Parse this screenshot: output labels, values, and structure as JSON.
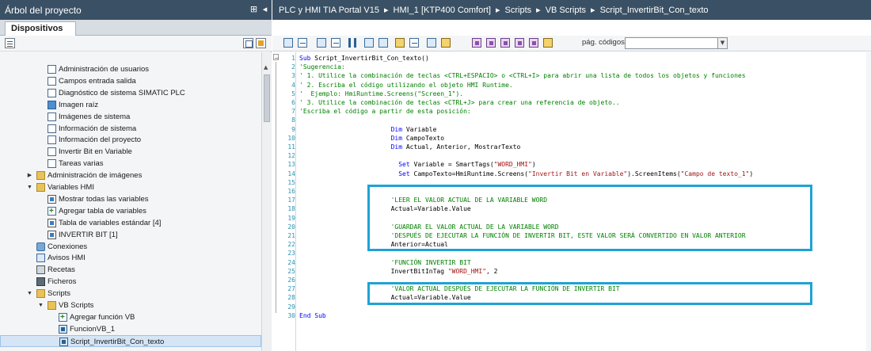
{
  "colors": {
    "titlebar_bg": "#3a5064",
    "selection_bg": "#d5e5f5",
    "keyword": "#0000ff",
    "comment": "#008000",
    "string": "#a31515",
    "line_number": "#2b91af",
    "highlight_box": "#1fa2d6"
  },
  "left_pane": {
    "title": "Árbol del proyecto",
    "pin_icon": "⊞",
    "collapse_icon": "◂",
    "tab_label": "Dispositivos",
    "tree": [
      {
        "label": "Administración de usuarios",
        "icon": "screen-icon"
      },
      {
        "label": "Campos entrada salida",
        "icon": "screen-icon"
      },
      {
        "label": "Diagnóstico de sistema SIMATIC PLC",
        "icon": "screen-icon"
      },
      {
        "label": "Imagen raíz",
        "icon": "screen-icon-blue"
      },
      {
        "label": "Imágenes de sistema",
        "icon": "screen-icon"
      },
      {
        "label": "Información de sistema",
        "icon": "screen-icon"
      },
      {
        "label": "Información del proyecto",
        "icon": "screen-icon"
      },
      {
        "label": "Invertir Bit en Variable",
        "icon": "screen-icon"
      },
      {
        "label": "Tareas varias",
        "icon": "screen-icon"
      },
      {
        "label": "Administración de imágenes",
        "icon": "folder-icon",
        "expander": "▶"
      },
      {
        "label": "Variables HMI",
        "icon": "folder-icon",
        "expander": "▼"
      },
      {
        "label": "Mostrar todas las variables",
        "icon": "tag-table-icon"
      },
      {
        "label": "Agregar tabla de variables",
        "icon": "add-icon"
      },
      {
        "label": "Tabla de variables estándar [4]",
        "icon": "tag-table-icon"
      },
      {
        "label": "INVERTIR BIT [1]",
        "icon": "tag-table-icon"
      },
      {
        "label": "Conexiones",
        "icon": "connection-icon"
      },
      {
        "label": "Avisos HMI",
        "icon": "alarm-icon"
      },
      {
        "label": "Recetas",
        "icon": "recipe-icon"
      },
      {
        "label": "Ficheros",
        "icon": "archive-icon"
      },
      {
        "label": "Scripts",
        "icon": "folder-icon",
        "expander": "▼"
      },
      {
        "label": "VB Scripts",
        "icon": "folder-icon",
        "expander": "▼"
      },
      {
        "label": "Agregar función VB",
        "icon": "add-icon"
      },
      {
        "label": "FuncionVB_1",
        "icon": "vb-script-icon"
      },
      {
        "label": "Script_InvertirBit_Con_texto",
        "icon": "vb-script-icon",
        "selected": true
      }
    ]
  },
  "breadcrumb": [
    "PLC y HMI TIA Portal V15",
    "HMI_1 [KTP400 Comfort]",
    "Scripts",
    "VB Scripts",
    "Script_InvertirBit_Con_texto"
  ],
  "breadcrumb_separator": "▸",
  "editor_toolbar": {
    "page_label": "pág. códigos",
    "page_value": "",
    "dropdown_arrow": "▼"
  },
  "code_lines": [
    [
      {
        "t": "Sub ",
        "c": "kw"
      },
      {
        "t": "Script_InvertirBit_Con_texto()",
        "c": ""
      }
    ],
    [
      {
        "t": "'Sugerencia:",
        "c": "cm"
      }
    ],
    [
      {
        "t": "' 1. Utilice la combinación de teclas <CTRL+ESPACIO> o <CTRL+I> para abrir una lista de todos los objetos y funciones",
        "c": "cm"
      }
    ],
    [
      {
        "t": "' 2. Escriba el código utilizando el objeto HMI Runtime.",
        "c": "cm"
      }
    ],
    [
      {
        "t": "'  Ejemplo: HmiRuntime.Screens(\"Screen_1\").",
        "c": "cm"
      }
    ],
    [
      {
        "t": "' 3. Utilice la combinación de teclas <CTRL+J> para crear una referencia de objeto..",
        "c": "cm"
      }
    ],
    [
      {
        "t": "'Escriba el código a partir de esta posición:",
        "c": "cm"
      }
    ],
    [
      {
        "t": "",
        "c": ""
      }
    ],
    [
      {
        "t": "                        ",
        "c": ""
      },
      {
        "t": "Dim",
        "c": "kw"
      },
      {
        "t": " Variable",
        "c": ""
      }
    ],
    [
      {
        "t": "                        ",
        "c": ""
      },
      {
        "t": "Dim",
        "c": "kw"
      },
      {
        "t": " CampoTexto",
        "c": ""
      }
    ],
    [
      {
        "t": "                        ",
        "c": ""
      },
      {
        "t": "Dim",
        "c": "kw"
      },
      {
        "t": " Actual, Anterior, MostrarTexto",
        "c": ""
      }
    ],
    [
      {
        "t": "",
        "c": ""
      }
    ],
    [
      {
        "t": "                          ",
        "c": ""
      },
      {
        "t": "Set",
        "c": "kw"
      },
      {
        "t": " Variable = SmartTags(",
        "c": ""
      },
      {
        "t": "\"WORD_HMI\"",
        "c": "st"
      },
      {
        "t": ")",
        "c": ""
      }
    ],
    [
      {
        "t": "                          ",
        "c": ""
      },
      {
        "t": "Set",
        "c": "kw"
      },
      {
        "t": " CampoTexto=HmiRuntime.Screens(",
        "c": ""
      },
      {
        "t": "\"Invertir Bit en Variable\"",
        "c": "st"
      },
      {
        "t": ").ScreenItems(",
        "c": ""
      },
      {
        "t": "\"Campo de texto_1\"",
        "c": "st"
      },
      {
        "t": ")",
        "c": ""
      }
    ],
    [
      {
        "t": "",
        "c": ""
      }
    ],
    [
      {
        "t": "",
        "c": ""
      }
    ],
    [
      {
        "t": "                        ",
        "c": ""
      },
      {
        "t": "'LEER EL VALOR ACTUAL DE LA VARIABLE WORD",
        "c": "cm"
      }
    ],
    [
      {
        "t": "                        ",
        "c": ""
      },
      {
        "t": "Actual=Variable.Value",
        "c": ""
      }
    ],
    [
      {
        "t": "",
        "c": ""
      }
    ],
    [
      {
        "t": "                        ",
        "c": ""
      },
      {
        "t": "'GUARDAR EL VALOR ACTUAL DE LA VARIABLE WORD",
        "c": "cm"
      }
    ],
    [
      {
        "t": "                        ",
        "c": ""
      },
      {
        "t": "'DESPUÉS DE EJECUTAR LA FUNCIÓN DE INVERTIR BIT, ESTE VALOR SERÁ CONVERTIDO EN VALOR ANTERIOR",
        "c": "cm"
      }
    ],
    [
      {
        "t": "                        ",
        "c": ""
      },
      {
        "t": "Anterior=Actual",
        "c": ""
      }
    ],
    [
      {
        "t": "",
        "c": ""
      }
    ],
    [
      {
        "t": "                        ",
        "c": ""
      },
      {
        "t": "'FUNCIÓN INVERTIR BIT",
        "c": "cm"
      }
    ],
    [
      {
        "t": "                        ",
        "c": ""
      },
      {
        "t": "InvertBitInTag ",
        "c": ""
      },
      {
        "t": "\"WORD_HMI\"",
        "c": "st"
      },
      {
        "t": ", 2",
        "c": ""
      }
    ],
    [
      {
        "t": "",
        "c": ""
      }
    ],
    [
      {
        "t": "                        ",
        "c": ""
      },
      {
        "t": "'VALOR ACTUAL DESPUÉS DE EJECUTAR LA FUNCIÓN DE INVERTIR BIT",
        "c": "cm"
      }
    ],
    [
      {
        "t": "                        ",
        "c": ""
      },
      {
        "t": "Actual=Variable.Value",
        "c": ""
      }
    ],
    [
      {
        "t": "",
        "c": ""
      }
    ],
    [
      {
        "t": "End Sub",
        "c": "kw"
      }
    ]
  ],
  "highlighted_line_ranges": [
    [
      16,
      22
    ],
    [
      27,
      28
    ]
  ]
}
